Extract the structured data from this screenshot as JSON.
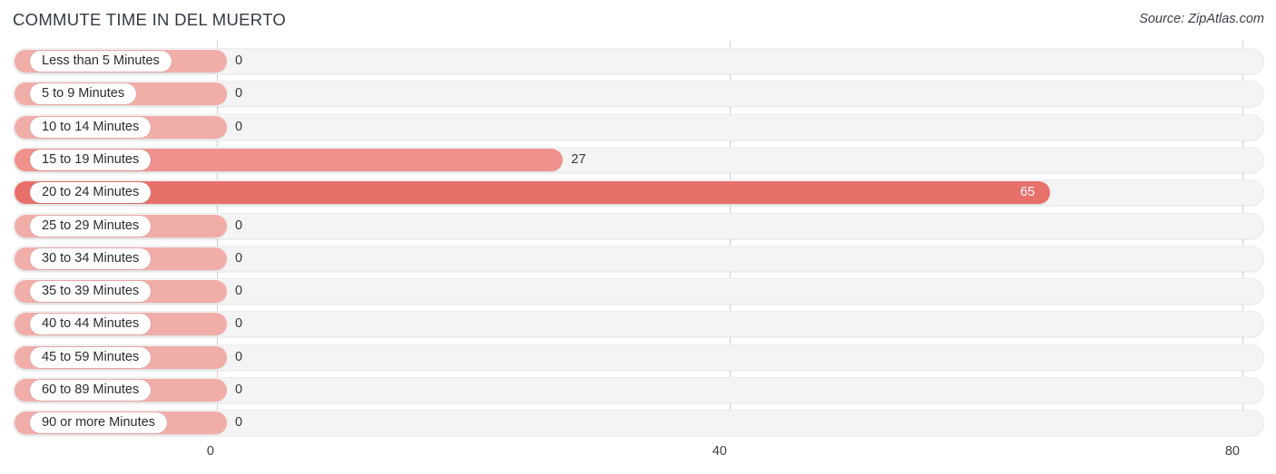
{
  "header": {
    "title": "COMMUTE TIME IN DEL MUERTO",
    "source": "Source: ZipAtlas.com"
  },
  "colors": {
    "bar_zero": "#f1ada8",
    "bar_mid": "#ef918c",
    "bar_high": "#e8706b",
    "track": "#f4f4f4",
    "gridline": "#d0d0d0",
    "title": "#333a44",
    "value_text": "#33383f",
    "value_text_inside": "#ffffff"
  },
  "chart_data": {
    "type": "bar",
    "orientation": "horizontal",
    "title": "COMMUTE TIME IN DEL MUERTO",
    "xlabel": "",
    "ylabel": "",
    "xlim": [
      0,
      80
    ],
    "grid": true,
    "legend": "none",
    "xticks": [
      "0",
      "40",
      "80"
    ],
    "xtick_values": [
      0,
      40,
      80
    ],
    "categories": [
      "Less than 5 Minutes",
      "5 to 9 Minutes",
      "10 to 14 Minutes",
      "15 to 19 Minutes",
      "20 to 24 Minutes",
      "25 to 29 Minutes",
      "30 to 34 Minutes",
      "35 to 39 Minutes",
      "40 to 44 Minutes",
      "45 to 59 Minutes",
      "60 to 89 Minutes",
      "90 or more Minutes"
    ],
    "values": [
      0,
      0,
      0,
      27,
      65,
      0,
      0,
      0,
      0,
      0,
      0,
      0
    ],
    "value_labels": [
      "0",
      "0",
      "0",
      "27",
      "65",
      "0",
      "0",
      "0",
      "0",
      "0",
      "0",
      "0"
    ]
  },
  "rows": [
    {
      "label": "Less than 5 Minutes",
      "value": 0,
      "value_label": "0",
      "inside": false
    },
    {
      "label": "5 to 9 Minutes",
      "value": 0,
      "value_label": "0",
      "inside": false
    },
    {
      "label": "10 to 14 Minutes",
      "value": 0,
      "value_label": "0",
      "inside": false
    },
    {
      "label": "15 to 19 Minutes",
      "value": 27,
      "value_label": "27",
      "inside": false
    },
    {
      "label": "20 to 24 Minutes",
      "value": 65,
      "value_label": "65",
      "inside": true
    },
    {
      "label": "25 to 29 Minutes",
      "value": 0,
      "value_label": "0",
      "inside": false
    },
    {
      "label": "30 to 34 Minutes",
      "value": 0,
      "value_label": "0",
      "inside": false
    },
    {
      "label": "35 to 39 Minutes",
      "value": 0,
      "value_label": "0",
      "inside": false
    },
    {
      "label": "40 to 44 Minutes",
      "value": 0,
      "value_label": "0",
      "inside": false
    },
    {
      "label": "45 to 59 Minutes",
      "value": 0,
      "value_label": "0",
      "inside": false
    },
    {
      "label": "60 to 89 Minutes",
      "value": 0,
      "value_label": "0",
      "inside": false
    },
    {
      "label": "90 or more Minutes",
      "value": 0,
      "value_label": "0",
      "inside": false
    }
  ],
  "axis": {
    "ticks": [
      {
        "label": "0",
        "value": 0
      },
      {
        "label": "40",
        "value": 40
      },
      {
        "label": "80",
        "value": 80
      }
    ]
  }
}
